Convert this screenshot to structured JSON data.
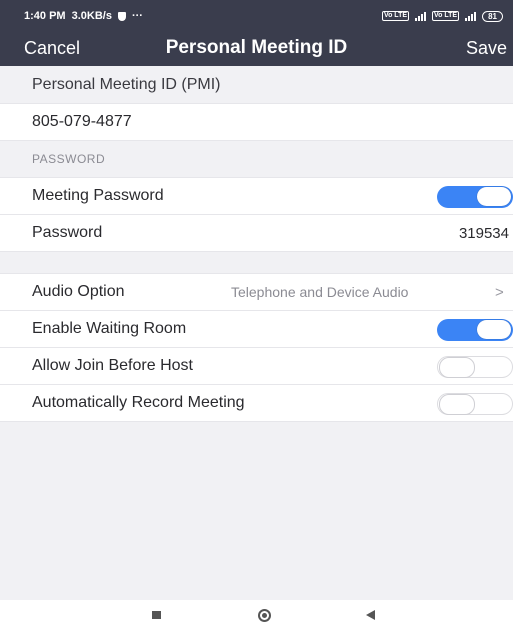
{
  "status": {
    "time": "1:40 PM",
    "speed": "3.0KB/s",
    "dots": "···",
    "volte1": "Vo LTE",
    "volte2": "Vo LTE",
    "battery": "81"
  },
  "nav": {
    "cancel": "Cancel",
    "title": "Personal Meeting ID",
    "save": "Save"
  },
  "pmi": {
    "label": "Personal Meeting ID (PMI)",
    "value": "805-079-4877"
  },
  "password_section": {
    "header": "PASSWORD",
    "meeting_password_label": "Meeting Password",
    "meeting_password_on": true,
    "password_label": "Password",
    "password_value": "319534"
  },
  "options": {
    "audio_label": "Audio Option",
    "audio_value": "Telephone and Device Audio",
    "audio_chevron": ">",
    "waiting_room_label": "Enable Waiting Room",
    "waiting_room_on": true,
    "join_before_host_label": "Allow Join Before Host",
    "join_before_host_on": false,
    "auto_record_label": "Automatically Record Meeting",
    "auto_record_on": false
  },
  "colors": {
    "header_bg": "#3a3d4d",
    "toggle_on": "#3b84f5",
    "page_bg": "#f1f1f4"
  }
}
